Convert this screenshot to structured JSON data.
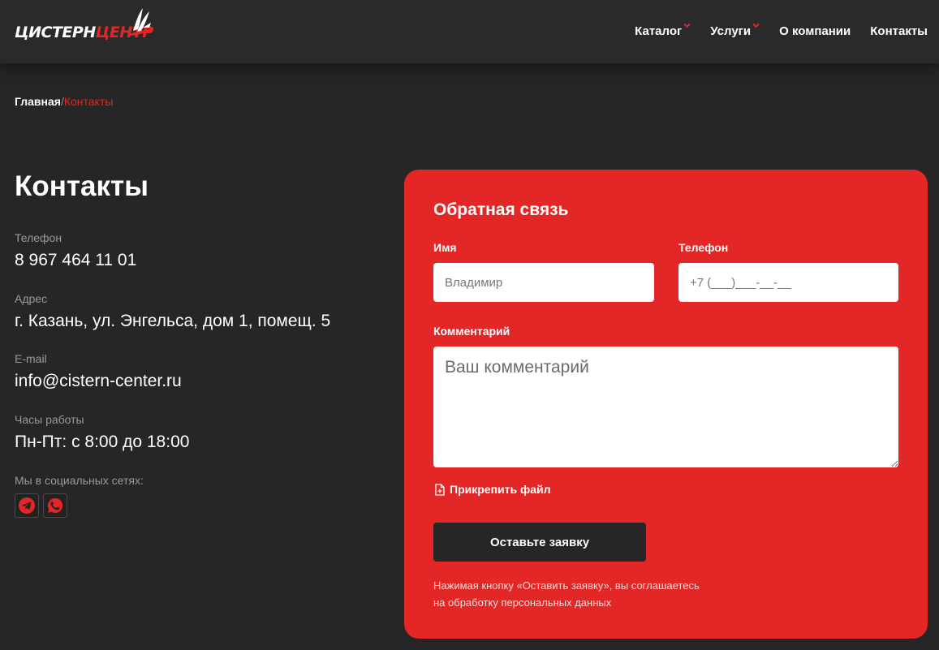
{
  "header": {
    "logo": {
      "part1": "ЦИСТЕРН",
      "part2": "ЦЕНТР"
    },
    "nav": [
      {
        "label": "Каталог",
        "has_dropdown": true
      },
      {
        "label": "Услуги",
        "has_dropdown": true
      },
      {
        "label": "О компании",
        "has_dropdown": false
      },
      {
        "label": "Контакты",
        "has_dropdown": false
      }
    ]
  },
  "breadcrumb": {
    "home": "Главная",
    "separator": "/",
    "current": "Контакты"
  },
  "page_title": "Контакты",
  "contacts": {
    "phone": {
      "label": "Телефон",
      "value": "8 967 464 11 01"
    },
    "address": {
      "label": "Адрес",
      "value": "г. Казань, ул. Энгельса, дом 1, помещ. 5"
    },
    "email": {
      "label": "E-mail",
      "value": "info@cistern-center.ru"
    },
    "hours": {
      "label": "Часы работы",
      "value": "Пн-Пт: с 8:00 до 18:00"
    },
    "socials": {
      "label": "Мы в социальных сетях:",
      "items": [
        "telegram-icon",
        "whatsapp-icon"
      ]
    }
  },
  "form": {
    "title": "Обратная связь",
    "name": {
      "label": "Имя",
      "placeholder": "Владимир"
    },
    "phone": {
      "label": "Телефон",
      "placeholder": "+7 (___)___-__-__"
    },
    "comment": {
      "label": "Комментарий",
      "placeholder": "Ваш комментарий"
    },
    "attach_label": "Прикрепить файл",
    "submit_label": "Оставьте заявку",
    "consent_line1": "Нажимая кнопку «Оставить заявку», вы соглашаетесь",
    "consent_line2": "на обработку персональных данных"
  },
  "colors": {
    "accent": "#e32626",
    "background": "#262626",
    "header": "#2a2a2a"
  }
}
